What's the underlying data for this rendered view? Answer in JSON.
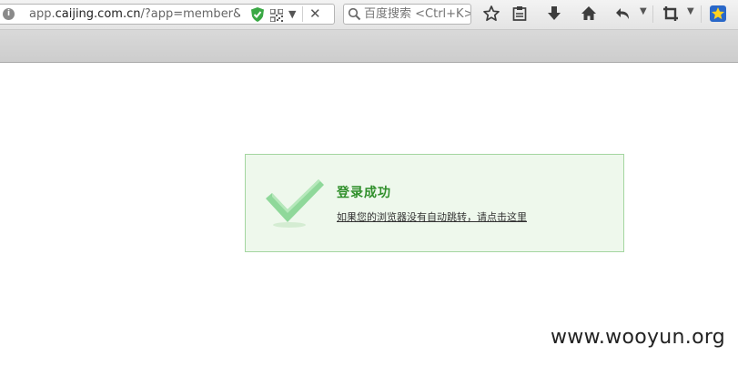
{
  "browser": {
    "url": {
      "prefix": "app.",
      "domain": "caijing.com.cn",
      "rest": "/?app=member&cc"
    },
    "search": {
      "placeholder": "百度搜索 <Ctrl+K>"
    },
    "icons": {
      "site": "globe-icon",
      "shield": "shield-icon",
      "qr": "qr-code-icon",
      "bookmark": "star-icon",
      "reader": "reading-list-icon",
      "download": "download-icon",
      "home": "home-icon",
      "back": "undo-icon",
      "screenshot": "crop-icon",
      "extension": "extension-star-icon"
    }
  },
  "page": {
    "title": "登录成功",
    "link_text": "如果您的浏览器没有自动跳转，请点击这里",
    "colors": {
      "box_bg": "#eef8ec",
      "box_border": "#a4d6a0",
      "title": "#2f8f2a",
      "check": "#8fd89a"
    }
  },
  "watermark": "www.wooyun.org"
}
